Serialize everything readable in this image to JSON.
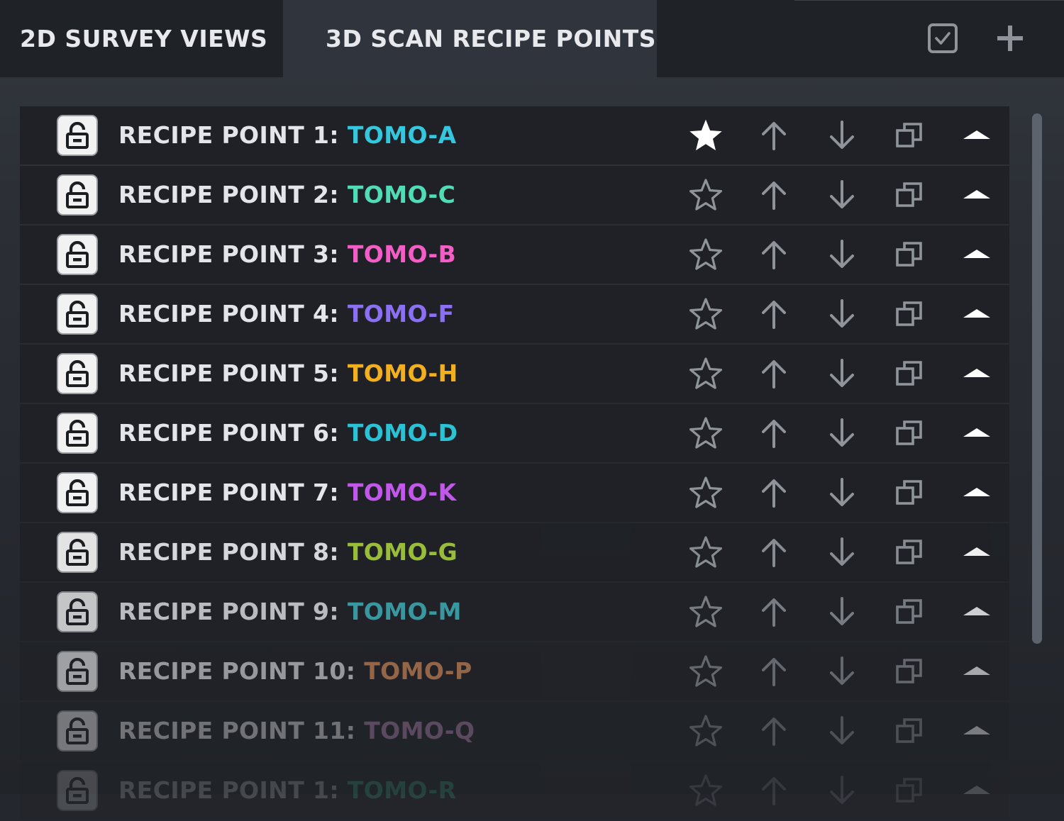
{
  "tabs": {
    "survey_label": "2D SURVEY VIEWS",
    "recipe_label": "3D SCAN RECIPE POINTS"
  },
  "colors": {
    "accent_white": "#ffffff",
    "icon_gray": "#8f949b"
  },
  "recipe_points": [
    {
      "prefix": "RECIPE POINT 1:",
      "name": "TOMO-A",
      "color": "#35c7dd",
      "starred": true,
      "opacity": 1.0
    },
    {
      "prefix": "RECIPE POINT 2:",
      "name": "TOMO-C",
      "color": "#4fdcb6",
      "starred": false,
      "opacity": 1.0
    },
    {
      "prefix": "RECIPE POINT 3:",
      "name": "TOMO-B",
      "color": "#f25dc6",
      "starred": false,
      "opacity": 1.0
    },
    {
      "prefix": "RECIPE POINT 4:",
      "name": "TOMO-F",
      "color": "#8c70f4",
      "starred": false,
      "opacity": 1.0
    },
    {
      "prefix": "RECIPE POINT 5:",
      "name": "TOMO-H",
      "color": "#f2b01e",
      "starred": false,
      "opacity": 1.0
    },
    {
      "prefix": "RECIPE POINT 6:",
      "name": "TOMO-D",
      "color": "#2ac3d6",
      "starred": false,
      "opacity": 1.0
    },
    {
      "prefix": "RECIPE POINT 7:",
      "name": "TOMO-K",
      "color": "#c158ea",
      "starred": false,
      "opacity": 1.0
    },
    {
      "prefix": "RECIPE POINT 8:",
      "name": "TOMO-G",
      "color": "#a3c83c",
      "starred": false,
      "opacity": 0.93
    },
    {
      "prefix": "RECIPE POINT 9:",
      "name": "TOMO-M",
      "color": "#3fb7bf",
      "starred": false,
      "opacity": 0.78
    },
    {
      "prefix": "RECIPE POINT 10:",
      "name": "TOMO-P",
      "color": "#e0915a",
      "starred": false,
      "opacity": 0.6
    },
    {
      "prefix": "RECIPE POINT 11:",
      "name": "TOMO-Q",
      "color": "#b27fae",
      "starred": false,
      "opacity": 0.4
    },
    {
      "prefix": "RECIPE POINT 1:",
      "name": "TOMO-R",
      "color": "#3cc3a0",
      "starred": false,
      "opacity": 0.18
    }
  ]
}
